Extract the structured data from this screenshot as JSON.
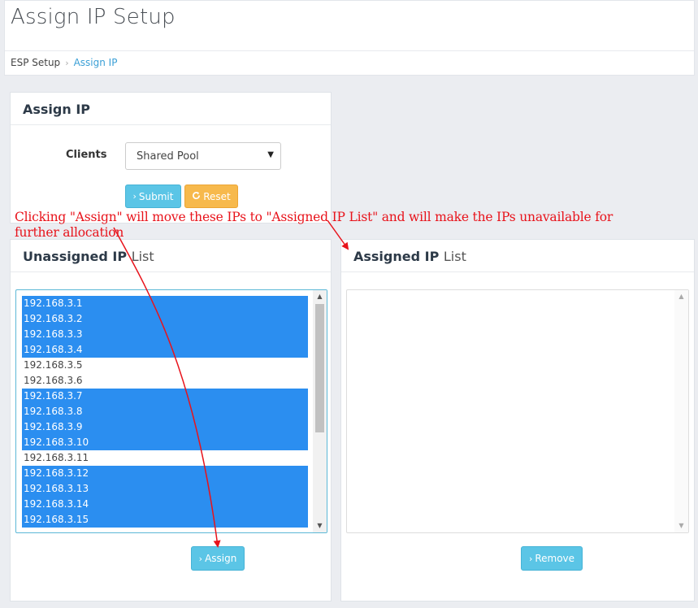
{
  "header": {
    "title": "Assign IP Setup",
    "breadcrumb": {
      "home": "ESP Setup",
      "separator": "›",
      "current": "Assign IP"
    }
  },
  "assign_panel": {
    "title": "Assign IP",
    "clients_label": "Clients",
    "clients_selected": "Shared Pool",
    "submit_label": "Submit",
    "reset_label": "Reset",
    "submit_icon": "chevron-right-icon",
    "reset_icon": "refresh-icon"
  },
  "unassigned_panel": {
    "title_bold": "Unassigned IP",
    "title_light": "List",
    "items": [
      {
        "ip": "192.168.3.1",
        "selected": true
      },
      {
        "ip": "192.168.3.2",
        "selected": true
      },
      {
        "ip": "192.168.3.3",
        "selected": true
      },
      {
        "ip": "192.168.3.4",
        "selected": true
      },
      {
        "ip": "192.168.3.5",
        "selected": false
      },
      {
        "ip": "192.168.3.6",
        "selected": false
      },
      {
        "ip": "192.168.3.7",
        "selected": true
      },
      {
        "ip": "192.168.3.8",
        "selected": true
      },
      {
        "ip": "192.168.3.9",
        "selected": true
      },
      {
        "ip": "192.168.3.10",
        "selected": true
      },
      {
        "ip": "192.168.3.11",
        "selected": false
      },
      {
        "ip": "192.168.3.12",
        "selected": true
      },
      {
        "ip": "192.168.3.13",
        "selected": true
      },
      {
        "ip": "192.168.3.14",
        "selected": true
      },
      {
        "ip": "192.168.3.15",
        "selected": true
      }
    ],
    "assign_label": "Assign"
  },
  "assigned_panel": {
    "title_bold": "Assigned IP",
    "title_light": "List",
    "remove_label": "Remove"
  },
  "annotation": {
    "text": "Clicking \"Assign\" will move these IPs to \"Assigned IP List\" and will make the IPs unavailable for further allocation",
    "color": "#e8131b"
  },
  "colors": {
    "selection": "#2b8ef0",
    "info_button": "#5bc5e6",
    "warning_button": "#f7b94c",
    "breadcrumb_active": "#3a9fd6"
  }
}
